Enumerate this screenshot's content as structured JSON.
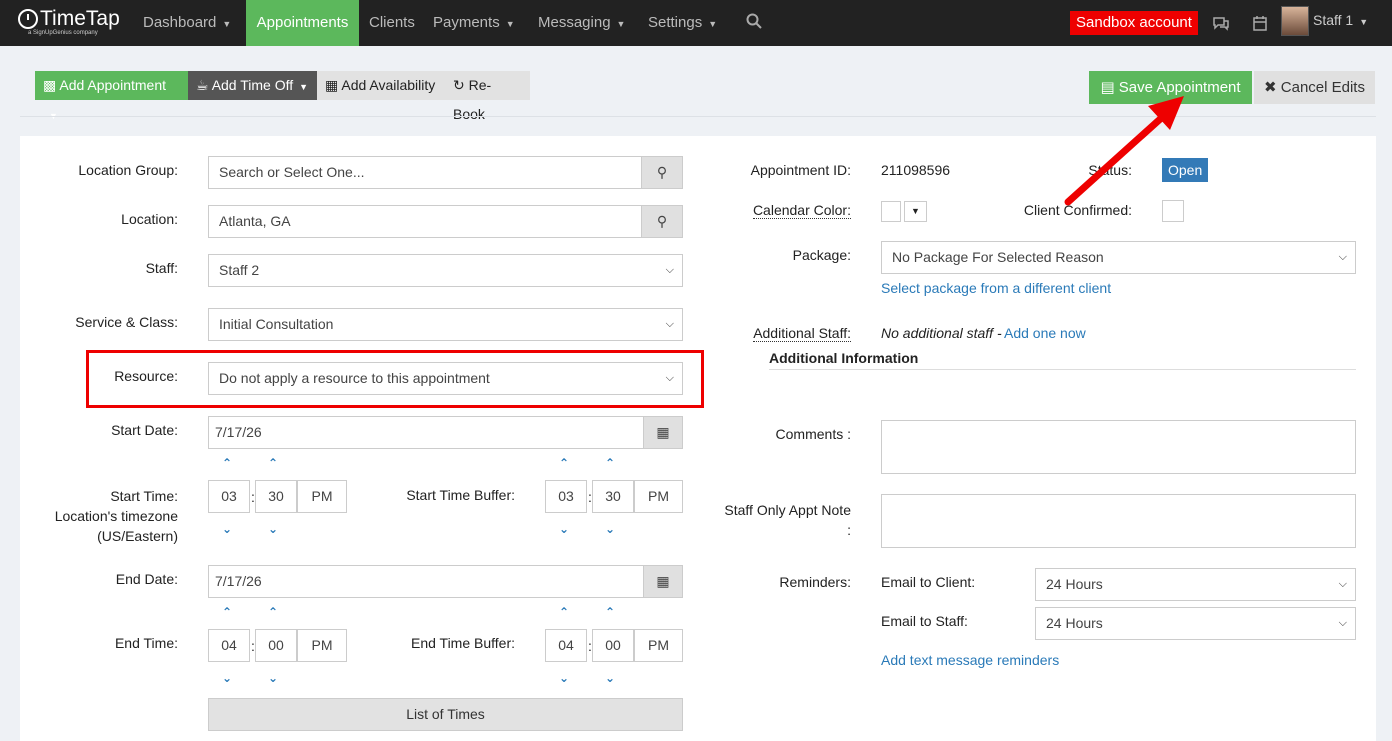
{
  "nav": {
    "logo": "TimeTap",
    "logo_sub": "a SignUpGenius company",
    "items": [
      "Dashboard",
      "Appointments",
      "Clients",
      "Payments",
      "Messaging",
      "Settings"
    ],
    "sandbox": "Sandbox account",
    "user": "Staff 1"
  },
  "toolbar": {
    "add_appointment": "Add Appointment",
    "add_time_off": "Add Time Off",
    "add_availability": "Add Availability",
    "rebook": "Re-Book",
    "save": "Save Appointment",
    "cancel": "Cancel Edits"
  },
  "form": {
    "location_group_label": "Location Group:",
    "location_group_placeholder": "Search or Select One...",
    "location_label": "Location:",
    "location_value": "Atlanta, GA",
    "staff_label": "Staff:",
    "staff_value": "Staff 2",
    "service_label": "Service & Class:",
    "service_value": "Initial Consultation",
    "resource_label": "Resource:",
    "resource_value": "Do not apply a resource to this appointment",
    "start_date_label": "Start Date:",
    "start_date": "7/17/26",
    "start_time_label_1": "Start Time:",
    "start_time_label_2": "Location's timezone",
    "start_time_label_3": "(US/Eastern)",
    "start_hour": "03",
    "start_min": "30",
    "start_ampm": "PM",
    "start_buffer_label": "Start Time Buffer:",
    "start_buf_hour": "03",
    "start_buf_min": "30",
    "start_buf_ampm": "PM",
    "end_date_label": "End Date:",
    "end_date": "7/17/26",
    "end_time_label": "End Time:",
    "end_hour": "04",
    "end_min": "00",
    "end_ampm": "PM",
    "end_buffer_label": "End Time Buffer:",
    "end_buf_hour": "04",
    "end_buf_min": "00",
    "end_buf_ampm": "PM",
    "list_times": "List of Times",
    "colon": ":"
  },
  "right": {
    "appt_id_label": "Appointment ID:",
    "appt_id": "211098596",
    "status_label": "Status:",
    "status": "Open",
    "calendar_color_label": "Calendar Color:",
    "client_confirmed_label": "Client Confirmed:",
    "package_label": "Package:",
    "package_value": "No Package For Selected Reason",
    "package_link": "Select package from a different client",
    "additional_staff_label": "Additional Staff:",
    "additional_staff_none": "No additional staff - ",
    "additional_staff_link": "Add one now",
    "additional_info_heading": "Additional Information",
    "comments_label": "Comments :",
    "staff_note_label_1": "Staff Only Appt Note",
    "staff_note_label_2": ":",
    "reminders_label": "Reminders:",
    "email_client_label": "Email to Client:",
    "email_client_value": "24 Hours",
    "email_staff_label": "Email to Staff:",
    "email_staff_value": "24 Hours",
    "text_reminders_link": "Add text message reminders"
  },
  "colors": {
    "green": "#5cb85c",
    "nav_bg": "#222222",
    "annotation_red": "#ee0000",
    "link_blue": "#2a7ab8"
  }
}
